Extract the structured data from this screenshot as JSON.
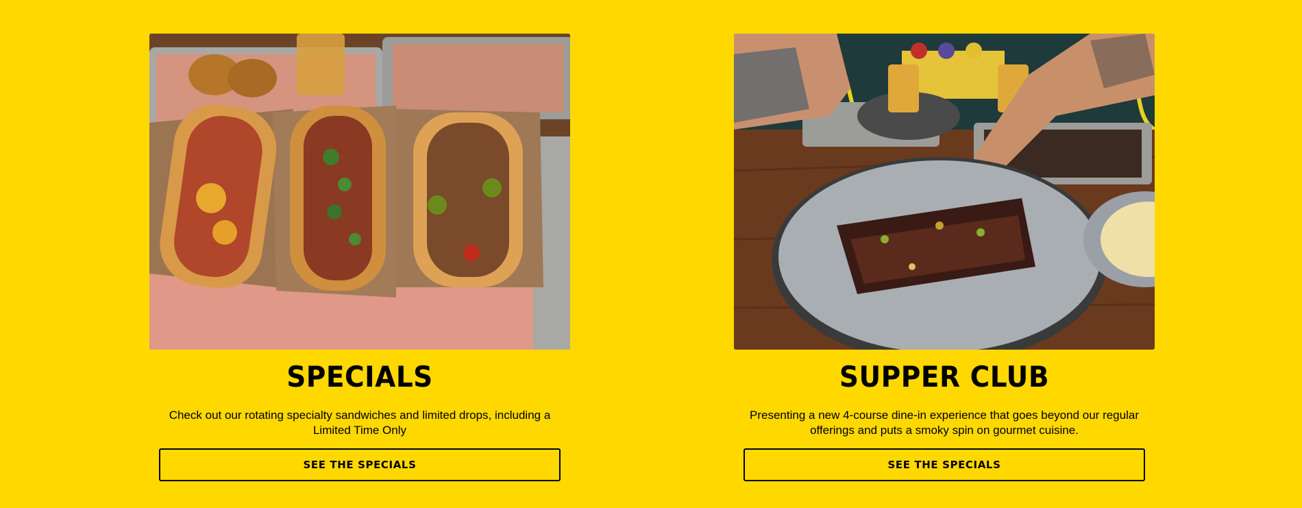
{
  "colors": {
    "background": "#FFD800",
    "text": "#000000",
    "button_border": "#000000"
  },
  "cards": [
    {
      "image_name": "specials-photo",
      "title": "SPECIALS",
      "description": "Check out our rotating specialty sandwiches and limited drops, including a Limited Time Only",
      "button_label": "SEE THE SPECIALS"
    },
    {
      "image_name": "supper-club-photo",
      "title": "SUPPER CLUB",
      "description": "Presenting a new 4-course dine-in experience that goes beyond our regular offerings and puts a smoky spin on gourmet cuisine.",
      "button_label": "SEE THE SPECIALS"
    }
  ]
}
